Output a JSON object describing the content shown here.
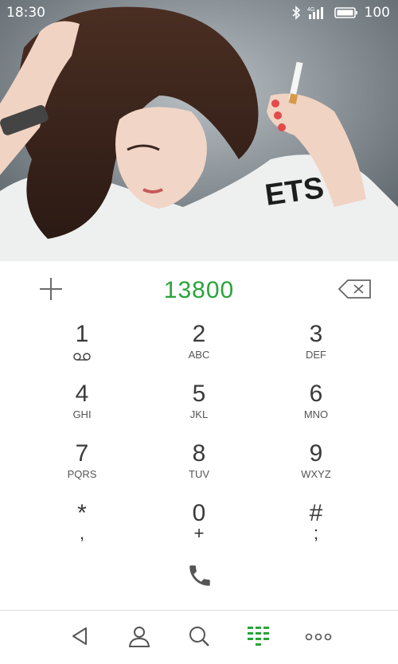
{
  "status_bar": {
    "time": "18:30",
    "network_label": "4G",
    "battery_percent": "100"
  },
  "dialer": {
    "number": "13800"
  },
  "keypad": {
    "rows": [
      [
        {
          "digit": "1",
          "sub": ""
        },
        {
          "digit": "2",
          "sub": "ABC"
        },
        {
          "digit": "3",
          "sub": "DEF"
        }
      ],
      [
        {
          "digit": "4",
          "sub": "GHI"
        },
        {
          "digit": "5",
          "sub": "JKL"
        },
        {
          "digit": "6",
          "sub": "MNO"
        }
      ],
      [
        {
          "digit": "7",
          "sub": "PQRS"
        },
        {
          "digit": "8",
          "sub": "TUV"
        },
        {
          "digit": "9",
          "sub": "WXYZ"
        }
      ],
      [
        {
          "digit": "*",
          "sub": ","
        },
        {
          "digit": "0",
          "sub": "+"
        },
        {
          "digit": "#",
          "sub": ";"
        }
      ]
    ]
  },
  "icons": {
    "add": "plus-icon",
    "backspace": "backspace-icon",
    "voicemail": "voicemail-icon",
    "call": "phone-icon",
    "nav_back": "back-triangle-icon",
    "nav_contacts": "person-icon",
    "nav_search": "search-icon",
    "nav_dialpad": "dialpad-icon",
    "nav_more": "more-icon"
  },
  "colors": {
    "accent": "#29a43a",
    "text": "#3a3a3a"
  }
}
